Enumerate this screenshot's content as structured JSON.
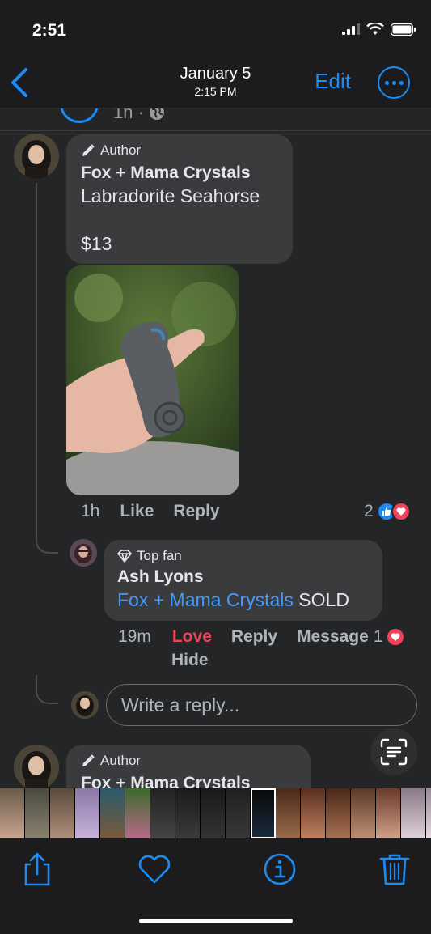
{
  "status": {
    "time": "2:51"
  },
  "nav": {
    "date": "January 5",
    "time": "2:15 PM",
    "edit_label": "Edit"
  },
  "prev_comment": {
    "meta": "1h ·"
  },
  "comment1": {
    "badge": "Author",
    "name": "Fox + Mama Crystals",
    "line1": "Labradorite Seahorse",
    "line2": "$13",
    "time": "1h",
    "like_label": "Like",
    "reply_label": "Reply",
    "reaction_count": "2"
  },
  "reply1": {
    "badge": "Top fan",
    "name": "Ash Lyons",
    "mention": "Fox + Mama Crystals",
    "text": "SOLD",
    "time": "19m",
    "love_label": "Love",
    "reply_label": "Reply",
    "message_label": "Message",
    "reaction_count": "1",
    "hide_label": "Hide"
  },
  "reply_box": {
    "placeholder": "Write a reply..."
  },
  "comment2": {
    "badge": "Author",
    "name": "Fox + Mama Crystals"
  },
  "colors": {
    "accent": "#1c8cf5",
    "love": "#f0435b",
    "link": "#4599ff",
    "bubble": "#3a3b3c"
  },
  "toolbar": {
    "icons": [
      "share-icon",
      "heart-icon",
      "info-icon",
      "trash-icon"
    ]
  }
}
